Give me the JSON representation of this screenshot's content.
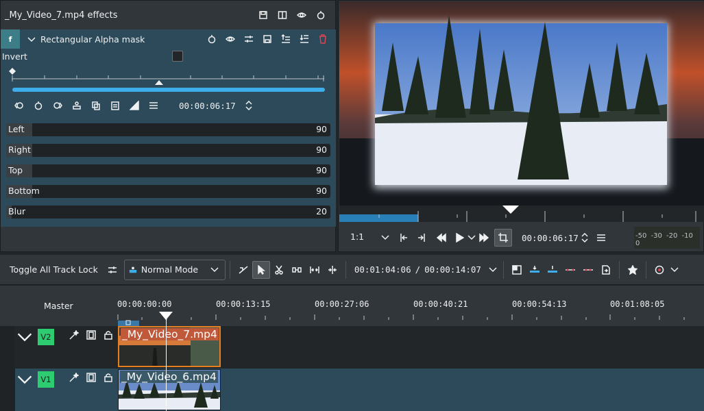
{
  "effects_panel": {
    "title": "_My_Video_7.mp4 effects",
    "effect": {
      "badge": "f",
      "name": "Rectangular Alpha mask",
      "invert_label": "Invert",
      "keyframe_time": "00:00:06:17",
      "params": [
        {
          "label": "Left",
          "value": "90"
        },
        {
          "label": "Right",
          "value": "90"
        },
        {
          "label": "Top",
          "value": "90"
        },
        {
          "label": "Bottom",
          "value": "90"
        },
        {
          "label": "Blur",
          "value": "20"
        }
      ]
    }
  },
  "monitor": {
    "zoom": "1:1",
    "timecode": "00:00:06:17",
    "vu_scale": "-50 -30 -20 -10 0"
  },
  "timeline_toolbar": {
    "toggle_lock_label": "Toggle All Track Lock",
    "mode": "Normal Mode",
    "position": "00:01:04:06",
    "separator": "/",
    "duration": "00:00:14:07"
  },
  "timeline": {
    "master_label": "Master",
    "ruler_labels": [
      "00:00:00:00",
      "00:00:13:15",
      "00:00:27:06",
      "00:00:40:21",
      "00:00:54:13",
      "00:01:08:05"
    ],
    "tracks": [
      {
        "badge": "V2",
        "clip": "_My_Video_7.mp4"
      },
      {
        "badge": "V1",
        "clip": "_My_Video_6.mp4"
      }
    ]
  },
  "colors": {
    "accent": "#3daee9",
    "selected_clip_border": "#e67e22",
    "track_badge": "#2ecc71",
    "effect_bg": "#2c4a5a",
    "delete_icon": "#da4453"
  }
}
